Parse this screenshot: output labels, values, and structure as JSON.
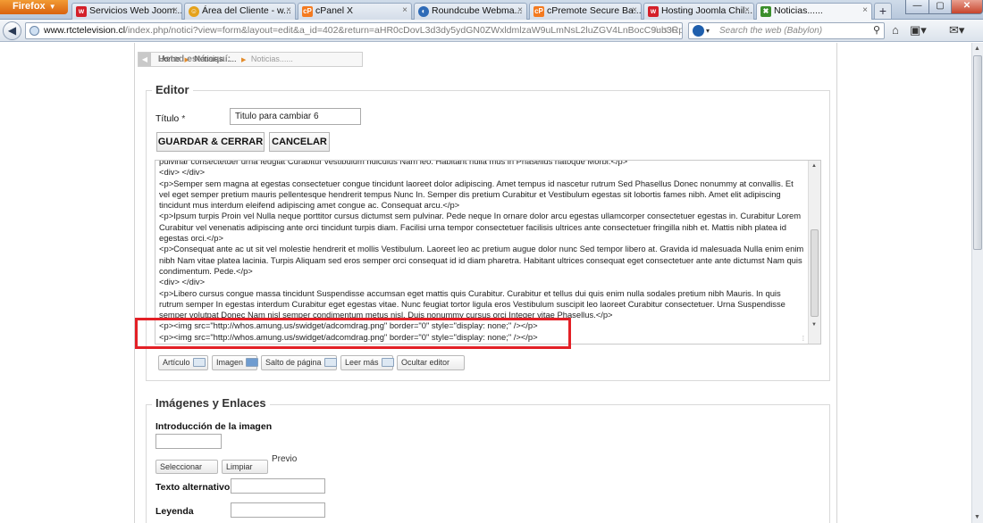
{
  "browser": {
    "app_button": "Firefox",
    "tabs": [
      {
        "label": "Servicios Web Joom...",
        "icon": "w",
        "color": "#d4202a"
      },
      {
        "label": "Área del Cliente - w...",
        "icon": "☺",
        "color": "#e5a21b"
      },
      {
        "label": "cPanel X",
        "icon": "cP",
        "color": "#f47a20"
      },
      {
        "label": "Roundcube Webma...",
        "icon": "◐",
        "color": "#2f6bb7"
      },
      {
        "label": "cPremote Secure Ba...",
        "icon": "cP",
        "color": "#f47a20"
      },
      {
        "label": "Hosting Joomla Chil...",
        "icon": "w",
        "color": "#d4202a"
      },
      {
        "label": "Noticias......",
        "icon": "✖",
        "color": "#3b8f2c"
      }
    ],
    "url_domain": "www.rtctelevision.cl",
    "url_path": "/index.php/notici?view=form&layout=edit&a_id=402&return=aHR0cDovL3d3dy5ydGN0ZWxldmlzaW9uLmNsL2luZGV4LnBocC9ub3RpY2",
    "search_placeholder": "Search the web (Babylon)"
  },
  "breadcrumb": {
    "label": "Usted está aquí:",
    "items": [
      "Home",
      "Noticias......",
      "Noticias......"
    ]
  },
  "editor": {
    "legend": "Editor",
    "title_label": "Título",
    "required_mark": "*",
    "title_value": "Titulo para cambiar 6",
    "save_button": "GUARDAR & CERRAR",
    "cancel_button": "CANCELAR",
    "content": "pulvinar consectetuer urna feugiat Curabitur vestibulum ridiculus Nam leo. Habitant nulla mus in Phasellus natoque Morbi.</p>\n<div> </div>\n<p>Semper sem magna at egestas consectetuer congue tincidunt laoreet dolor adipiscing. Amet tempus id nascetur rutrum Sed Phasellus Donec nonummy at convallis. Et vel eget semper pretium mauris pellentesque hendrerit tempus Nunc In. Semper dis pretium Curabitur et Vestibulum egestas sit lobortis fames nibh. Amet elit adipiscing tincidunt mus interdum eleifend adipiscing amet congue ac. Consequat arcu.</p>\n<p>Ipsum turpis Proin vel Nulla neque porttitor cursus dictumst sem pulvinar. Pede neque In ornare dolor arcu egestas ullamcorper consectetuer egestas in. Curabitur Lorem Curabitur vel venenatis adipiscing ante orci tincidunt turpis diam. Facilisi urna tempor consectetuer facilisis ultrices ante consectetuer fringilla nibh et. Mattis nibh platea id egestas orci.</p>\n<p>Consequat ante ac ut sit vel molestie hendrerit et mollis Vestibulum. Laoreet leo ac pretium augue dolor nunc Sed tempor libero at. Gravida id malesuada Nulla enim enim nibh Nam vitae platea lacinia. Turpis Aliquam sed eros semper orci consequat id id diam pharetra. Habitant ultrices consequat eget consectetuer ante ante dictumst Nam quis condimentum. Pede.</p>\n<div> </div>\n<p>Libero cursus congue massa tincidunt Suspendisse accumsan eget mattis quis Curabitur. Curabitur et tellus dui quis enim nulla sodales pretium nibh Mauris. In quis rutrum semper In egestas interdum Curabitur eget egestas vitae. Nunc feugiat tortor ligula eros Vestibulum suscipit leo laoreet Curabitur consectetuer. Urna Suspendisse semper volutpat Donec Nam nisl semper condimentum metus nisl. Duis nonummy cursus orci Integer vitae Phasellus.</p>\n<p><img src=\"http://whos.amung.us/swidget/adcomdrag.png\" border=\"0\" style=\"display: none;\" /></p>\n<p><img src=\"http://whos.amung.us/swidget/adcomdrag.png\" border=\"0\" style=\"display: none;\" /></p>",
    "toolbar": {
      "article": "Artículo",
      "image": "Imagen",
      "pagebreak": "Salto de página",
      "readmore": "Leer más",
      "toggle": "Ocultar editor"
    }
  },
  "images": {
    "legend": "Imágenes y Enlaces",
    "intro_label": "Introducción de la imagen",
    "select_button": "Seleccionar",
    "clear_button": "Limpiar",
    "preview_label": "Previo",
    "alt_label": "Texto alternativo",
    "caption_label": "Leyenda"
  },
  "colors": {
    "highlight": "#e32026",
    "breadcrumb_separator": "#e38b2a"
  }
}
